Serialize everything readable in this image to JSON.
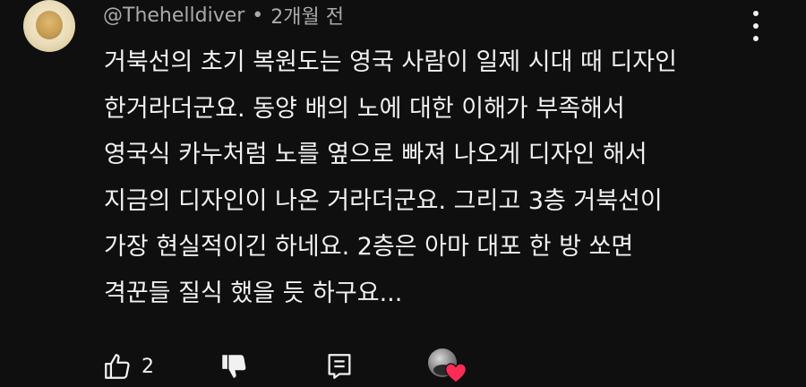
{
  "comment": {
    "author": "@Thehelldiver",
    "separator": "•",
    "time": "2개월 전",
    "lines": [
      "거북선의 초기 복원도는 영국 사람이 일제 시대 때 디자인",
      "한거라더군요. 동양 배의 노에 대한 이해가 부족해서",
      "영국식 카누처럼 노를 옆으로 빠져 나오게 디자인 해서",
      "지금의 디자인이 나온 거라더군요. 그리고 3층 거북선이",
      "가장 현실적이긴 하네요. 2층은 아마 대포 한 방 쏘면",
      "격꾼들 질식 했을 듯 하구요..."
    ]
  },
  "actions": {
    "like_count": "2",
    "like_icon": "thumb-up-icon",
    "dislike_icon": "thumb-down-icon",
    "reply_icon": "reply-icon",
    "creator_heart_icon": "heart-icon",
    "heart_color": "#ff2d55"
  },
  "menu_icon": "more-vertical-icon"
}
